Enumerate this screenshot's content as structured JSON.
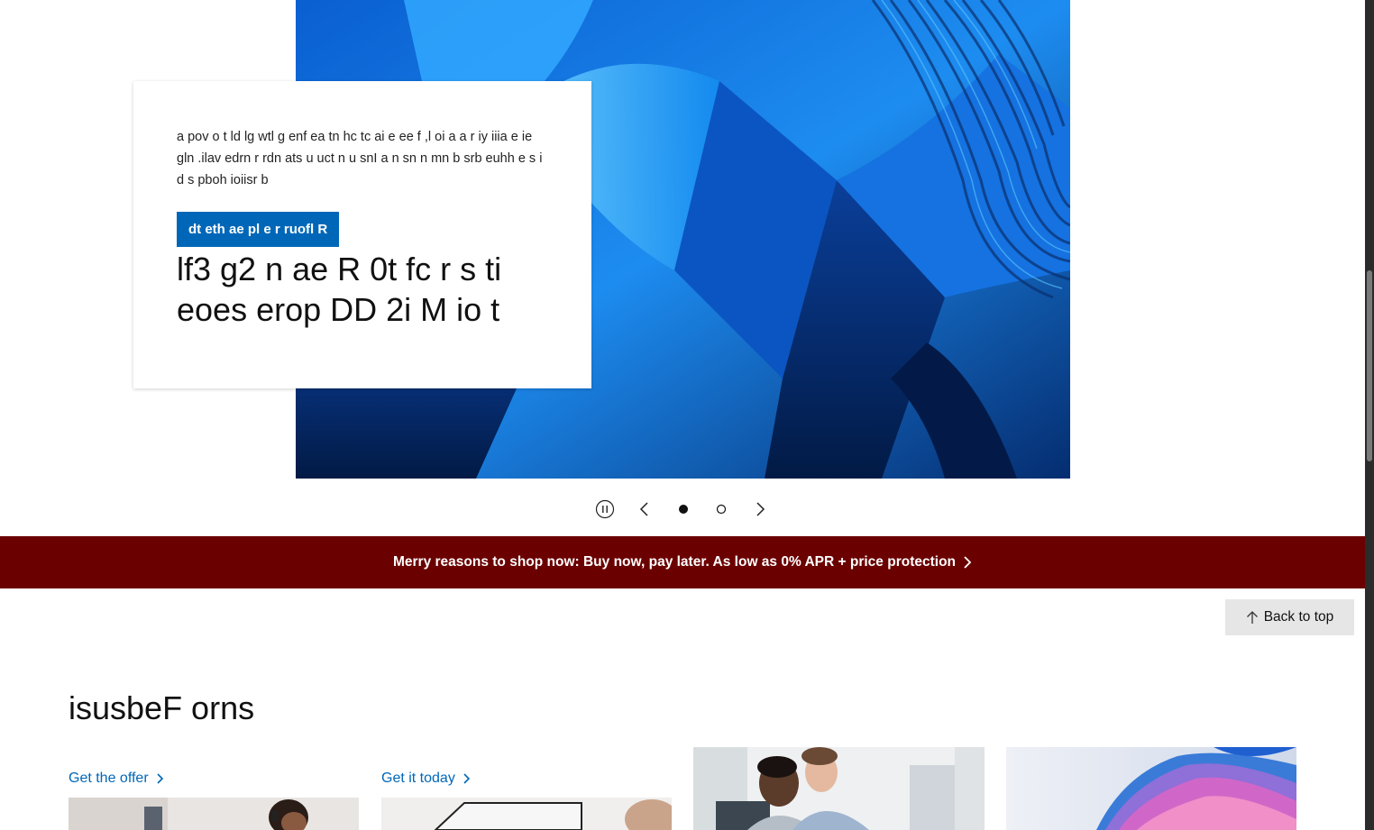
{
  "hero": {
    "description": "a pov o t ld lg wtl g enf ea tn hc tc ai e ee f ,l oi a a r iy iiia e ie gln .ilav edrn r rdn ats u uct n u snI a n sn n mn b srb euhh e s i d s pboh ioiisr b",
    "cta_label": "dt eth ae pl e r ruofl R",
    "heading": "lf3 g2 n ae R 0t fc r s ti eoes erop DD 2i M io t"
  },
  "carousel": {
    "slide_count": 2,
    "active_slide": 1
  },
  "promo": {
    "text": "Merry reasons to shop now: Buy now, pay later. As low as 0% APR + price protection"
  },
  "back_to_top": {
    "label": "Back to top"
  },
  "featured": {
    "title": "isusbeF orns",
    "cards": [
      {
        "link_label": "Get the offer"
      },
      {
        "link_label": "Get it today"
      }
    ]
  },
  "colors": {
    "accent": "#0067b8",
    "promo_bg": "#6b0000",
    "hero_blue": "#1f8fff"
  }
}
